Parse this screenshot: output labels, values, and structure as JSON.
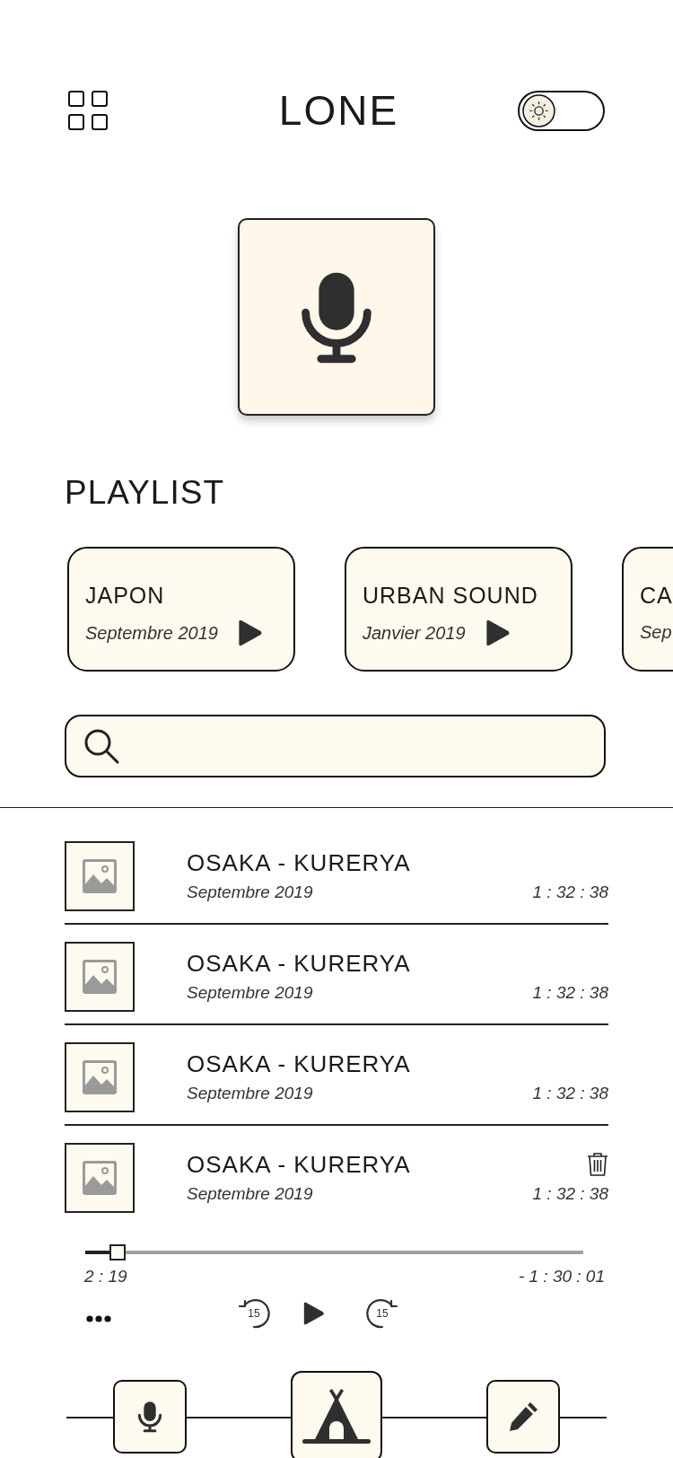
{
  "header": {
    "title": "LONE",
    "theme_toggle": {
      "on": false
    }
  },
  "playlist": {
    "heading": "PLAYLIST",
    "cards": [
      {
        "title": "JAPON",
        "date": "Septembre 2019"
      },
      {
        "title": "URBAN SOUND",
        "date": "Janvier 2019"
      },
      {
        "title": "CA",
        "date": "Sep"
      }
    ]
  },
  "tracks": [
    {
      "title": "OSAKA - KURERYA",
      "date": "Septembre 2019",
      "duration": "1 : 32 : 38",
      "deletable": false
    },
    {
      "title": "OSAKA - KURERYA",
      "date": "Septembre 2019",
      "duration": "1 : 32 : 38",
      "deletable": false
    },
    {
      "title": "OSAKA - KURERYA",
      "date": "Septembre 2019",
      "duration": "1 : 32 : 38",
      "deletable": false
    },
    {
      "title": "OSAKA - KURERYA",
      "date": "Septembre 2019",
      "duration": "1 : 32 : 38",
      "deletable": true
    }
  ],
  "player": {
    "level": 0.065,
    "elapsed": "2 : 19",
    "remaining": "- 1 : 30 : 01",
    "skip_back": "15",
    "skip_forward": "15"
  },
  "bottom_nav": [
    {
      "kind": "mic",
      "selected": false
    },
    {
      "kind": "tent",
      "selected": true
    },
    {
      "kind": "pencil",
      "selected": false
    }
  ]
}
